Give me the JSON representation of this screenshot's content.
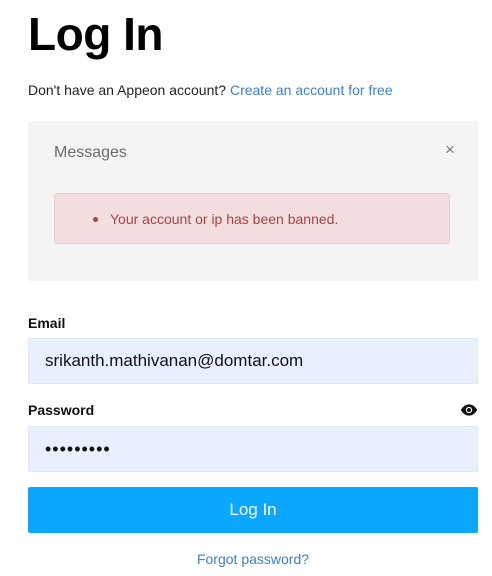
{
  "header": {
    "title": "Log In",
    "signup_prompt": "Don't have an Appeon account?",
    "signup_link": "Create an account for free"
  },
  "messages": {
    "title": "Messages",
    "close_symbol": "×",
    "errors": [
      "Your account or ip has been banned."
    ]
  },
  "form": {
    "email_label": "Email",
    "email_value": "srikanth.mathivanan@domtar.com",
    "password_label": "Password",
    "password_value": "•••••••••",
    "show_password_icon": "eye-icon",
    "submit_label": "Log In",
    "forgot_link": "Forgot password?"
  },
  "colors": {
    "link": "#3d82c4",
    "primary_button": "#0aa7ff",
    "input_background": "#e8f0fe",
    "error_text": "#a94442",
    "error_background": "#f2dede",
    "messages_background": "#f4f4f4"
  }
}
